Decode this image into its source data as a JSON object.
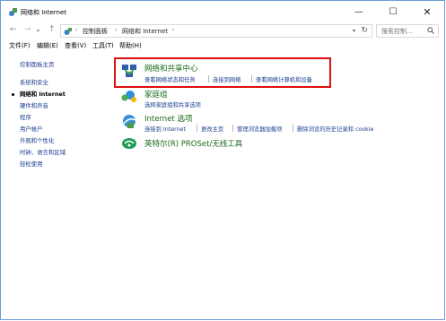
{
  "window": {
    "title": "网络和 Internet",
    "controls": {
      "minimize": "—",
      "maximize": "☐",
      "close": "✕"
    }
  },
  "nav": {
    "back": "←",
    "forward": "→",
    "dropdown": "▾",
    "up": "↑"
  },
  "address": {
    "sep": "›",
    "crumbs": [
      "控制面板",
      "网络和 Internet"
    ],
    "dropdown": "▾",
    "refresh": "↻"
  },
  "search": {
    "placeholder": "搜索控制..."
  },
  "menu": [
    "文件(F)",
    "编辑(E)",
    "查看(V)",
    "工具(T)",
    "帮助(H)"
  ],
  "sidebar": {
    "items": [
      "控制面板主页",
      "系统和安全",
      "网络和 Internet",
      "硬件和声音",
      "程序",
      "用户帐户",
      "外观和个性化",
      "时钟、语言和区域",
      "轻松使用"
    ],
    "current_index": 2
  },
  "sections": [
    {
      "title": "网络和共享中心",
      "links": [
        "查看网络状态和任务",
        "连接到网络",
        "查看网络计算机和设备"
      ],
      "icon": "network-sharing-icon",
      "highlighted": true
    },
    {
      "title": "家庭组",
      "links": [
        "选择家庭组和共享选项"
      ],
      "icon": "homegroup-icon"
    },
    {
      "title": "Internet 选项",
      "links": [
        "连接到 Internet",
        "更改主页",
        "管理浏览器加载项",
        "删除浏览的历史记录和 cookie"
      ],
      "icon": "internet-options-icon"
    },
    {
      "title": "英特尔(R) PROSet/无线工具",
      "links": [],
      "icon": "intel-proset-icon"
    }
  ],
  "colors": {
    "link": "#1a3d8f",
    "section_title": "#1a6a1a",
    "highlight": "#e01010",
    "border": "#6d9cd6"
  }
}
